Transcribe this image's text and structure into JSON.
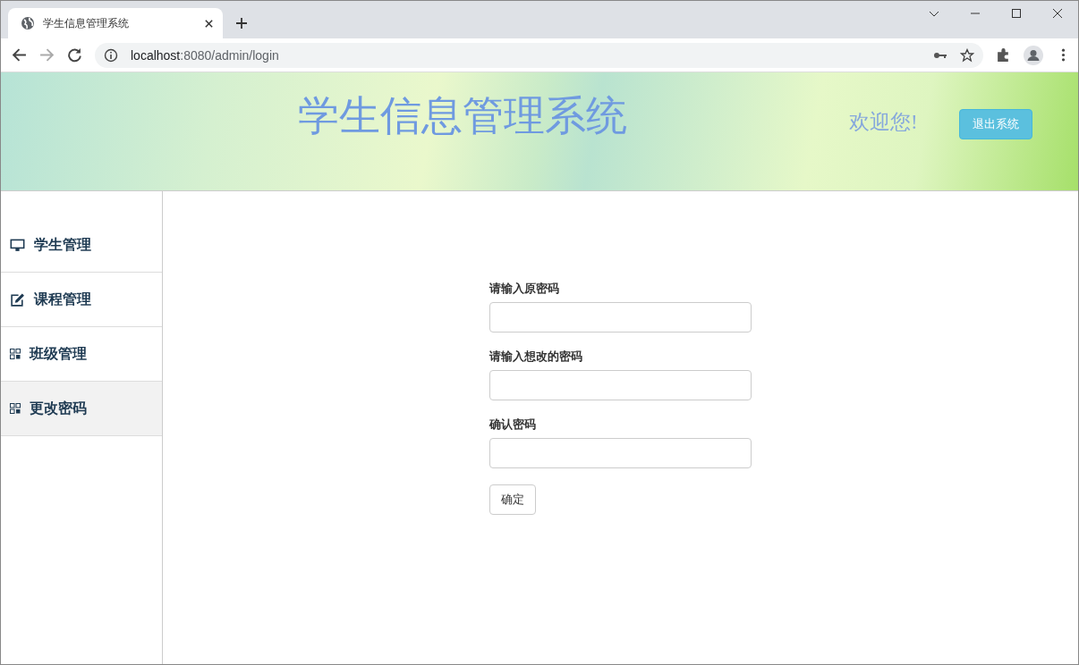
{
  "browser": {
    "tab_title": "学生信息管理系统",
    "url_host": "localhost",
    "url_path": ":8080/admin/login"
  },
  "header": {
    "title": "学生信息管理系统",
    "welcome": "欢迎您!",
    "logout_button": "退出系统"
  },
  "sidebar": {
    "items": [
      {
        "label": "学生管理",
        "kind": "monitor",
        "selected": false
      },
      {
        "label": "课程管理",
        "kind": "edit",
        "selected": false
      },
      {
        "label": "班级管理",
        "kind": "grid",
        "selected": false
      },
      {
        "label": "更改密码",
        "kind": "grid",
        "selected": true
      }
    ]
  },
  "form": {
    "fields": [
      {
        "label": "请输入原密码"
      },
      {
        "label": "请输入想改的密码"
      },
      {
        "label": "确认密码"
      }
    ],
    "submit": "确定"
  }
}
